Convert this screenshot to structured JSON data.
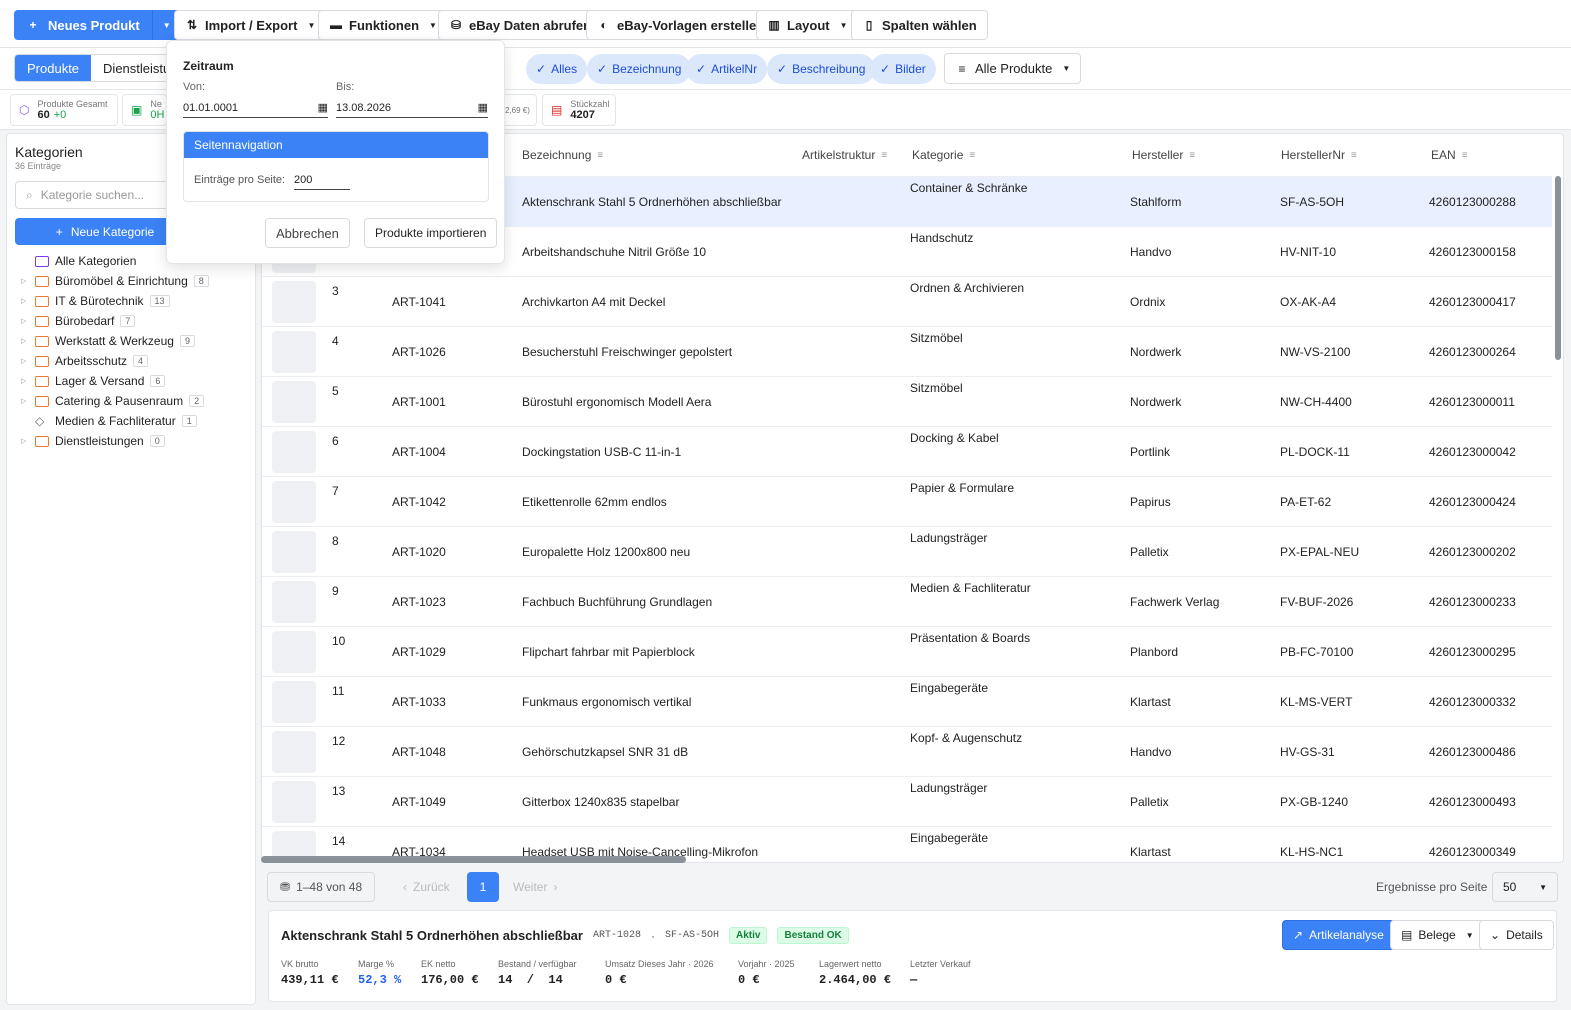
{
  "toolbar": {
    "new_product": "Neues Produkt",
    "import_export": "Import / Export",
    "functions": "Funktionen",
    "ebay_fetch": "eBay Daten abrufen",
    "ebay_templates": "eBay-Vorlagen erstellen",
    "layout": "Layout",
    "columns": "Spalten wählen"
  },
  "tabs": [
    "Produkte",
    "Dienstleistu"
  ],
  "filters": {
    "chips": [
      "Alles",
      "Bezeichnung",
      "ArtikelNr",
      "Beschreibung",
      "Bilder"
    ],
    "view": "Alle Produkte"
  },
  "stats": {
    "total_label": "Produkte Gesamt",
    "total_value": "60",
    "total_delta": "+0",
    "second_label": "Ne",
    "second_value": "0H",
    "hidden_tail": "2,69 €)",
    "pieces_label": "Stückzahl",
    "pieces_value": "4207"
  },
  "sidebar": {
    "title": "Kategorien",
    "subtitle": "36 Einträge",
    "search_placeholder": "Kategorie suchen...",
    "new_button": "Neue Kategorie",
    "all": "Alle Kategorien",
    "items": [
      {
        "label": "Büromöbel & Einrichtung",
        "count": "8"
      },
      {
        "label": "IT & Bürotechnik",
        "count": "13"
      },
      {
        "label": "Bürobedarf",
        "count": "7"
      },
      {
        "label": "Werkstatt & Werkzeug",
        "count": "9"
      },
      {
        "label": "Arbeitsschutz",
        "count": "4"
      },
      {
        "label": "Lager & Versand",
        "count": "6"
      },
      {
        "label": "Catering & Pausenraum",
        "count": "2"
      },
      {
        "label": "Medien & Fachliteratur",
        "count": "1"
      },
      {
        "label": "Dienstleistungen",
        "count": "0"
      }
    ]
  },
  "table": {
    "headers": [
      "Bezeichnung",
      "Artikelstruktur",
      "Kategorie",
      "Hersteller",
      "HerstellerNr",
      "EAN"
    ],
    "rows": [
      {
        "n": "",
        "art": "",
        "name": "Aktenschrank Stahl 5 Ordnerhöhen abschließbar",
        "cat": "Container & Schränke",
        "mfr": "Stahlform",
        "mno": "SF-AS-5OH",
        "ean": "4260123000288"
      },
      {
        "n": "",
        "art": "",
        "name": "Arbeitshandschuhe Nitril Größe 10",
        "cat": "Handschutz",
        "mfr": "Handvo",
        "mno": "HV-NIT-10",
        "ean": "4260123000158"
      },
      {
        "n": "3",
        "art": "ART-1041",
        "name": "Archivkarton A4 mit Deckel",
        "cat": "Ordnen & Archivieren",
        "mfr": "Ordnix",
        "mno": "OX-AK-A4",
        "ean": "4260123000417"
      },
      {
        "n": "4",
        "art": "ART-1026",
        "name": "Besucherstuhl Freischwinger gepolstert",
        "cat": "Sitzmöbel",
        "mfr": "Nordwerk",
        "mno": "NW-VS-2100",
        "ean": "4260123000264"
      },
      {
        "n": "5",
        "art": "ART-1001",
        "name": "Bürostuhl ergonomisch Modell Aera",
        "cat": "Sitzmöbel",
        "mfr": "Nordwerk",
        "mno": "NW-CH-4400",
        "ean": "4260123000011"
      },
      {
        "n": "6",
        "art": "ART-1004",
        "name": "Dockingstation USB-C 11-in-1",
        "cat": "Docking & Kabel",
        "mfr": "Portlink",
        "mno": "PL-DOCK-11",
        "ean": "4260123000042"
      },
      {
        "n": "7",
        "art": "ART-1042",
        "name": "Etikettenrolle 62mm endlos",
        "cat": "Papier & Formulare",
        "mfr": "Papirus",
        "mno": "PA-ET-62",
        "ean": "4260123000424"
      },
      {
        "n": "8",
        "art": "ART-1020",
        "name": "Europalette Holz 1200x800 neu",
        "cat": "Ladungsträger",
        "mfr": "Palletix",
        "mno": "PX-EPAL-NEU",
        "ean": "4260123000202"
      },
      {
        "n": "9",
        "art": "ART-1023",
        "name": "Fachbuch Buchführung Grundlagen",
        "cat": "Medien & Fachliteratur",
        "mfr": "Fachwerk Verlag",
        "mno": "FV-BUF-2026",
        "ean": "4260123000233"
      },
      {
        "n": "10",
        "art": "ART-1029",
        "name": "Flipchart fahrbar mit Papierblock",
        "cat": "Präsentation & Boards",
        "mfr": "Planbord",
        "mno": "PB-FC-70100",
        "ean": "4260123000295"
      },
      {
        "n": "11",
        "art": "ART-1033",
        "name": "Funkmaus ergonomisch vertikal",
        "cat": "Eingabegeräte",
        "mfr": "Klartast",
        "mno": "KL-MS-VERT",
        "ean": "4260123000332"
      },
      {
        "n": "12",
        "art": "ART-1048",
        "name": "Gehörschutzkapsel SNR 31 dB",
        "cat": "Kopf- & Augenschutz",
        "mfr": "Handvo",
        "mno": "HV-GS-31",
        "ean": "4260123000486"
      },
      {
        "n": "13",
        "art": "ART-1049",
        "name": "Gitterbox 1240x835 stapelbar",
        "cat": "Ladungsträger",
        "mfr": "Palletix",
        "mno": "PX-GB-1240",
        "ean": "4260123000493"
      },
      {
        "n": "14",
        "art": "ART-1034",
        "name": "Headset USB mit Noise-Cancelling-Mikrofon",
        "cat": "Eingabegeräte",
        "mfr": "Klartast",
        "mno": "KL-HS-NC1",
        "ean": "4260123000349"
      }
    ]
  },
  "pager": {
    "range": "1–48 von 48",
    "back": "Zurück",
    "page": "1",
    "next": "Weiter",
    "per_page_label": "Ergebnisse pro Seite",
    "per_page": "50"
  },
  "detail": {
    "title": "Aktenschrank Stahl 5 Ordnerhöhen abschließbar",
    "art": "ART-1028",
    "sep": "·",
    "mno": "SF-AS-5OH",
    "badge_active": "Aktiv",
    "badge_stock": "Bestand OK",
    "analysis": "Artikelanalyse",
    "documents": "Belege",
    "details": "Details",
    "metrics": [
      {
        "label": "VK brutto",
        "value": "439,11 €"
      },
      {
        "label": "Marge %",
        "value": "52,3 %"
      },
      {
        "label": "EK netto",
        "value": "176,00 €"
      },
      {
        "label": "Bestand / verfügbar",
        "value": "14  /  14"
      },
      {
        "label": "Umsatz Dieses Jahr · 2026",
        "value": "0 €"
      },
      {
        "label": "Vorjahr · 2025",
        "value": "0 €"
      },
      {
        "label": "Lagerwert netto",
        "value": "2.464,00 €"
      },
      {
        "label": "Letzter Verkauf",
        "value": "—"
      }
    ]
  },
  "popup": {
    "title": "Zeitraum",
    "from_label": "Von:",
    "from": "01.01.0001",
    "to_label": "Bis:",
    "to": "13.08.2026",
    "section": "Seitennavigation",
    "per_page_label": "Einträge pro Seite:",
    "per_page": "200",
    "cancel": "Abbrechen",
    "import": "Produkte importieren"
  },
  "colors": {
    "accent": "#3b82f6",
    "folder": "#ea7a32",
    "ok": "#15803d"
  }
}
